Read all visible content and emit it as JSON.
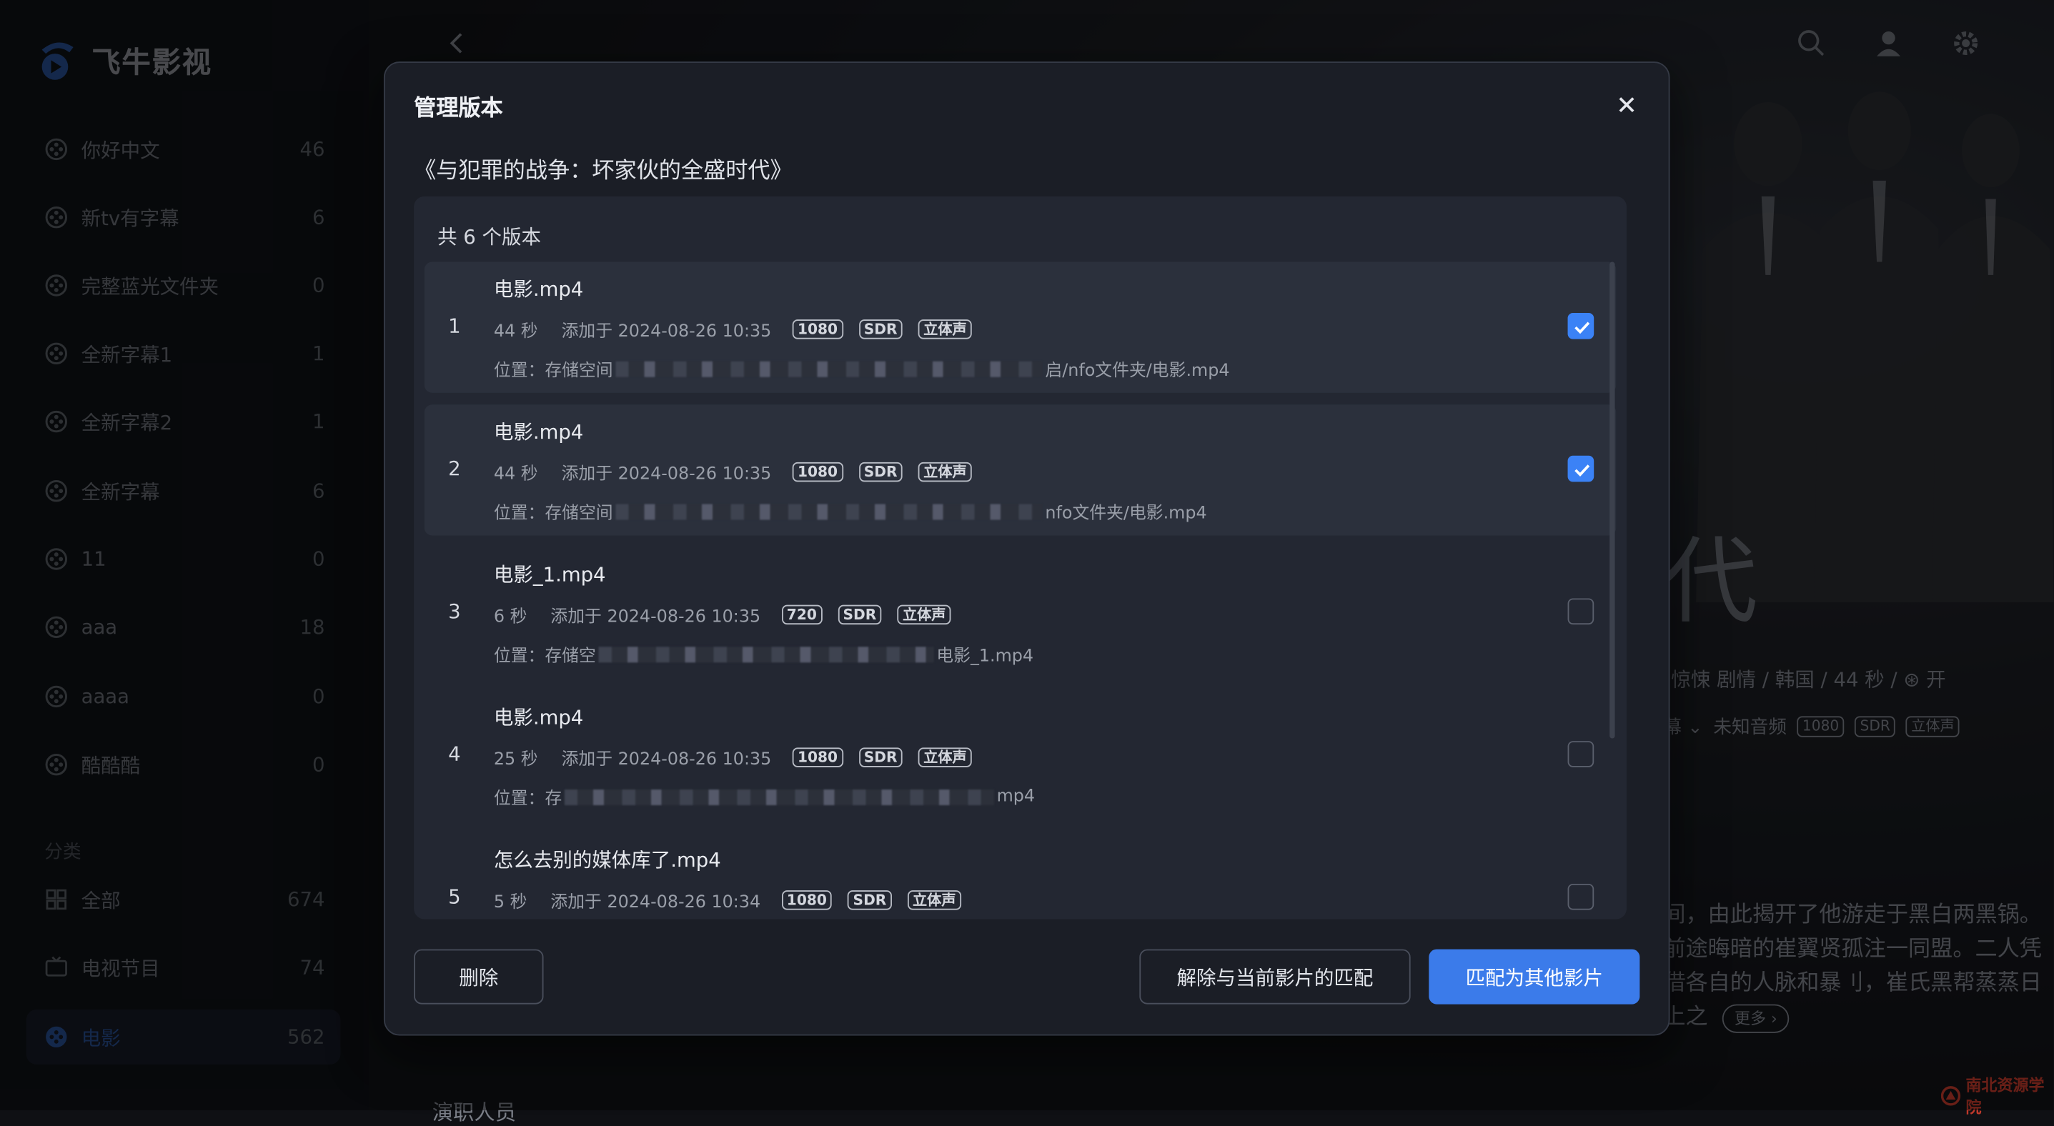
{
  "app": {
    "brand_name": "飞牛影视"
  },
  "sidebar": {
    "libraries": [
      {
        "label": "你好中文",
        "count": "46"
      },
      {
        "label": "新tv有字幕",
        "count": "6"
      },
      {
        "label": "完整蓝光文件夹",
        "count": "0"
      },
      {
        "label": "全新字幕1",
        "count": "1"
      },
      {
        "label": "全新字幕2",
        "count": "1"
      },
      {
        "label": "全新字幕",
        "count": "6"
      },
      {
        "label": "11",
        "count": "0"
      },
      {
        "label": "aaa",
        "count": "18"
      },
      {
        "label": "aaaa",
        "count": "0"
      },
      {
        "label": "酷酷酷",
        "count": "0"
      }
    ],
    "section_label": "分类",
    "categories": [
      {
        "label": "全部",
        "count": "674",
        "icon": "grid-icon"
      },
      {
        "label": "电视节目",
        "count": "74",
        "icon": "tv-icon"
      },
      {
        "label": "电影",
        "count": "562",
        "icon": "film-icon",
        "active": true
      }
    ]
  },
  "background": {
    "title_fragment": "代",
    "meta": "惊悚 剧情  /  韩国  /  44 秒  /  ⊛ 开",
    "audio_prefix": "幕 ⌄",
    "audio_label": "未知音频",
    "tags": [
      "1080",
      "SDR",
      "立体声"
    ],
    "description": "间，由此揭开了他游走于黑白两黑锅。前途晦暗的崔翼贤孤注一同盟。二人凭借各自的人脉和暴刂，崔氏黑帮蒸蒸日上之",
    "more_label": "更多 ›",
    "cast_label": "演职人员",
    "watermark": "南北资源学院"
  },
  "modal": {
    "title": "管理版本",
    "movie_title": "《与犯罪的战争：坏家伙的全盛时代》",
    "version_count": "共 6 个版本",
    "versions": [
      {
        "index": "1",
        "name": "电影.mp4",
        "duration": "44 秒",
        "added": "添加于 2024-08-26 10:35",
        "tags": [
          "1080",
          "SDR",
          "立体声"
        ],
        "path_prefix": "位置：存储空间",
        "path_suffix": "启/nfo文件夹/电影.mp4",
        "checked": true
      },
      {
        "index": "2",
        "name": "电影.mp4",
        "duration": "44 秒",
        "added": "添加于 2024-08-26 10:35",
        "tags": [
          "1080",
          "SDR",
          "立体声"
        ],
        "path_prefix": "位置：存储空间",
        "path_suffix": "nfo文件夹/电影.mp4",
        "checked": true
      },
      {
        "index": "3",
        "name": "电影_1.mp4",
        "duration": "6 秒",
        "added": "添加于 2024-08-26 10:35",
        "tags": [
          "720",
          "SDR",
          "立体声"
        ],
        "path_prefix": "位置：存储空",
        "path_suffix": "电影_1.mp4",
        "checked": false
      },
      {
        "index": "4",
        "name": "电影.mp4",
        "duration": "25 秒",
        "added": "添加于 2024-08-26 10:35",
        "tags": [
          "1080",
          "SDR",
          "立体声"
        ],
        "path_prefix": "位置：存",
        "path_suffix": "mp4",
        "checked": false
      },
      {
        "index": "5",
        "name": "怎么去别的媒体库了.mp4",
        "duration": "5 秒",
        "added": "添加于 2024-08-26 10:34",
        "tags": [
          "1080",
          "SDR",
          "立体声"
        ],
        "path_prefix": "",
        "path_suffix": "",
        "checked": false
      }
    ],
    "buttons": {
      "delete": "删除",
      "unmatch": "解除与当前影片的匹配",
      "rematch": "匹配为其他影片"
    },
    "colors": {
      "accent": "#3b7bea",
      "panel": "#232732",
      "selected_row": "#2b303c"
    }
  }
}
